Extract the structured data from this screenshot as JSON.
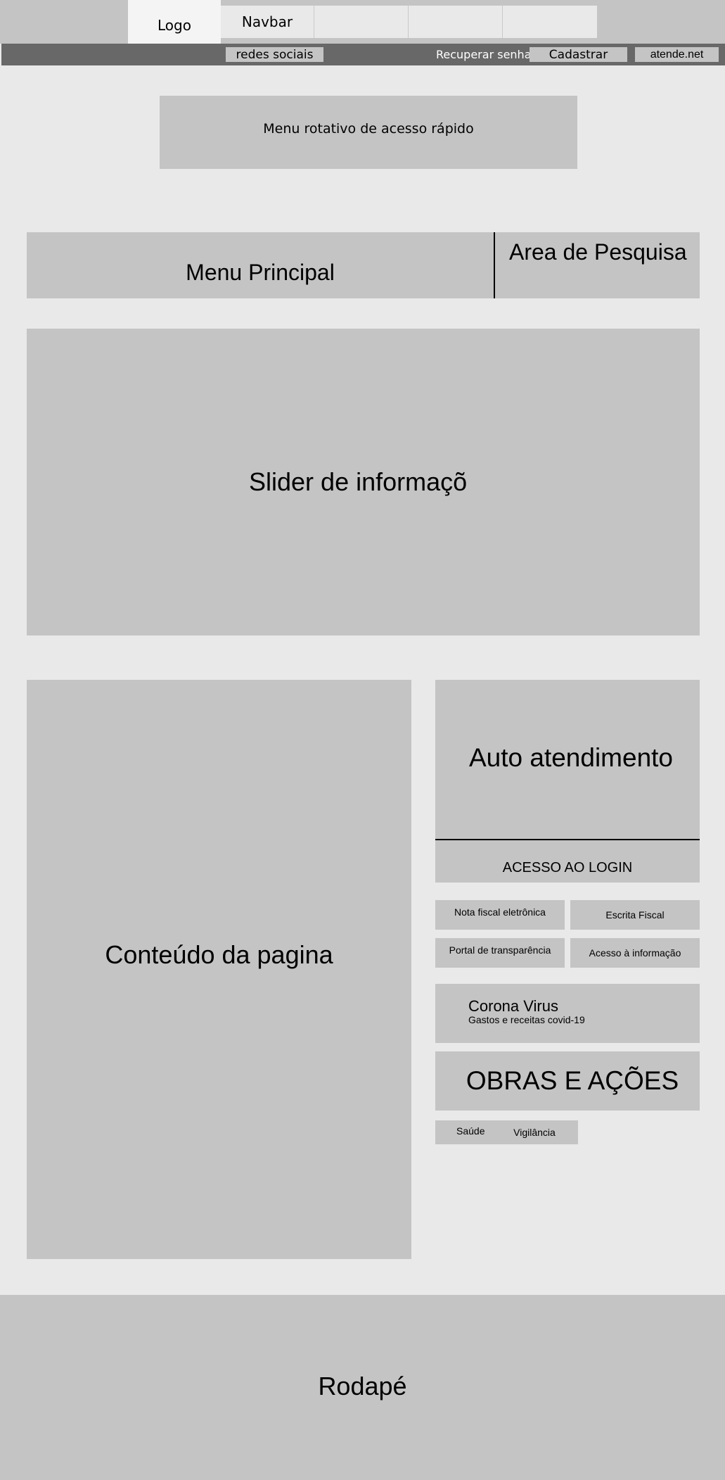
{
  "header": {
    "logo_label": "Logo",
    "nav_items": [
      "Navbar",
      "",
      "",
      ""
    ]
  },
  "topbar": {
    "social_label": "redes sociais",
    "recover_password_label": "Recuperar senha",
    "signup_label": "Cadastrar",
    "atende_label": "atende.net"
  },
  "quick_access": {
    "label": "Menu rotativo de acesso rápido"
  },
  "main_menu": {
    "label": "Menu Principal",
    "search_label": "Area de Pesquisa"
  },
  "slider": {
    "label": "Slider de informações"
  },
  "content": {
    "label": "Conteúdo da pagina"
  },
  "sidebar": {
    "self_service_label": "Auto atendimento",
    "login_label": "ACESSO AO LOGIN",
    "quick_links": [
      "Nota fiscal eletrônica",
      "Escrita Fiscal",
      "Portal de transparência",
      "Acesso à informação"
    ],
    "corona": {
      "title": "Corona Virus",
      "subtitle": "Gastos e receitas covid-19"
    },
    "works_label": "OBRAS E AÇÕES",
    "tags": [
      "Saúde",
      "Vigilância"
    ]
  },
  "footer": {
    "label": "Rodapé"
  },
  "colors": {
    "page_background": "#e9e9e9",
    "block_gray": "#c4c4c4",
    "dark_bar": "#686868",
    "logo_background": "#f4f4f4"
  }
}
